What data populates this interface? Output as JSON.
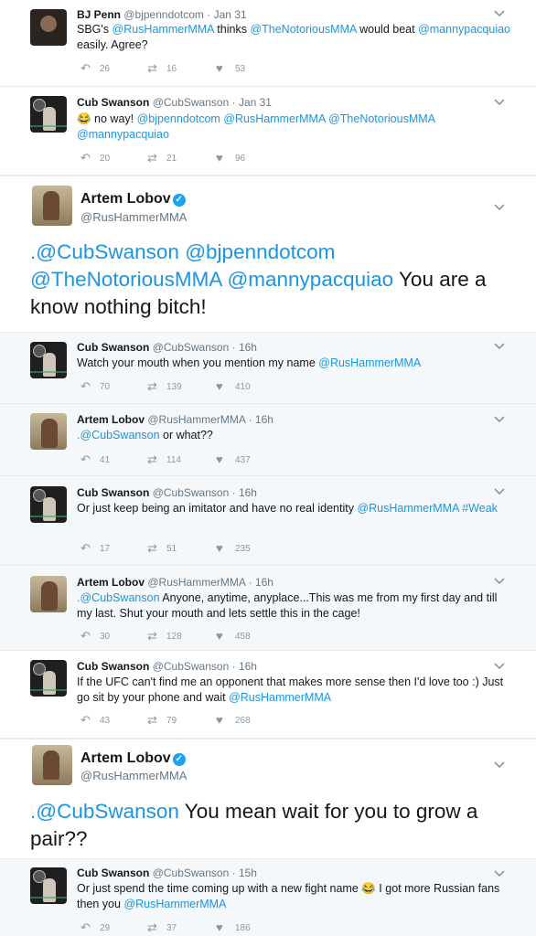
{
  "tweets": [
    {
      "name": "BJ Penn",
      "handle": "@bjpenndotcom",
      "time": "Jan 31",
      "segments": [
        {
          "text": "SBG's ",
          "link": false
        },
        {
          "text": "@RusHammerMMA",
          "link": true
        },
        {
          "text": " thinks ",
          "link": false
        },
        {
          "text": "@TheNotoriousMMA",
          "link": true
        },
        {
          "text": " would beat ",
          "link": false
        },
        {
          "text": "@mannypacquiao",
          "link": true
        },
        {
          "text": " easily. Agree?",
          "link": false
        }
      ],
      "replies": "26",
      "retweets": "16",
      "likes": "53"
    },
    {
      "name": "Cub Swanson",
      "handle": "@CubSwanson",
      "time": "Jan 31",
      "segments": [
        {
          "text": "😂 no way! ",
          "link": false
        },
        {
          "text": "@bjpenndotcom",
          "link": true
        },
        {
          "text": " ",
          "link": false
        },
        {
          "text": "@RusHammerMMA",
          "link": true
        },
        {
          "text": " ",
          "link": false
        },
        {
          "text": "@TheNotoriousMMA",
          "link": true
        },
        {
          "text": " ",
          "link": false
        },
        {
          "text": "@mannypacquiao",
          "link": true
        }
      ],
      "replies": "20",
      "retweets": "21",
      "likes": "96"
    },
    {
      "name": "Artem Lobov",
      "handle": "@RusHammerMMA",
      "segments": [
        {
          "text": ".@CubSwanson",
          "link": true
        },
        {
          "text": " ",
          "link": false
        },
        {
          "text": "@bjpenndotcom",
          "link": true
        },
        {
          "text": " ",
          "link": false
        },
        {
          "text": "@TheNotoriousMMA",
          "link": true
        },
        {
          "text": " ",
          "link": false
        },
        {
          "text": "@mannypacquiao",
          "link": true
        },
        {
          "text": " You are a know nothing bitch!",
          "link": false
        }
      ]
    },
    {
      "name": "Cub Swanson",
      "handle": "@CubSwanson",
      "time": "16h",
      "segments": [
        {
          "text": "Watch your mouth when you mention my name ",
          "link": false
        },
        {
          "text": "@RusHammerMMA",
          "link": true
        }
      ],
      "replies": "70",
      "retweets": "139",
      "likes": "410"
    },
    {
      "name": "Artem Lobov",
      "handle": "@RusHammerMMA",
      "time": "16h",
      "segments": [
        {
          "text": ".@CubSwanson",
          "link": true
        },
        {
          "text": " or what??",
          "link": false
        }
      ],
      "replies": "41",
      "retweets": "114",
      "likes": "437"
    },
    {
      "name": "Cub Swanson",
      "handle": "@CubSwanson",
      "time": "16h",
      "segments": [
        {
          "text": "Or just keep being an imitator and have no real identity ",
          "link": false
        },
        {
          "text": "@RusHammerMMA",
          "link": true
        },
        {
          "text": " ",
          "link": false
        },
        {
          "text": "#Weak",
          "link": true
        }
      ],
      "replies": "17",
      "retweets": "51",
      "likes": "235"
    },
    {
      "name": "Artem Lobov",
      "handle": "@RusHammerMMA",
      "time": "16h",
      "segments": [
        {
          "text": ".@CubSwanson",
          "link": true
        },
        {
          "text": " Anyone, anytime, anyplace...This was me from my first day and till my last. Shut your mouth and lets settle this in the cage!",
          "link": false
        }
      ],
      "replies": "30",
      "retweets": "128",
      "likes": "458"
    },
    {
      "name": "Cub Swanson",
      "handle": "@CubSwanson",
      "time": "16h",
      "segments": [
        {
          "text": "If the UFC can't find me an opponent that makes more sense then I'd love too :) Just go sit by your phone and wait ",
          "link": false
        },
        {
          "text": "@RusHammerMMA",
          "link": true
        }
      ],
      "replies": "43",
      "retweets": "79",
      "likes": "268"
    },
    {
      "name": "Artem Lobov",
      "handle": "@RusHammerMMA",
      "segments": [
        {
          "text": ".@CubSwanson",
          "link": true
        },
        {
          "text": " You mean wait for you to grow a pair??",
          "link": false
        }
      ]
    },
    {
      "name": "Cub Swanson",
      "handle": "@CubSwanson",
      "time": "15h",
      "segments": [
        {
          "text": "Or just spend the time coming up with a new fight name 😂 I got more Russian fans then you ",
          "link": false
        },
        {
          "text": "@RusHammerMMA",
          "link": true
        }
      ],
      "replies": "29",
      "retweets": "37",
      "likes": "186"
    }
  ],
  "icons": {
    "reply": "reply-icon",
    "retweet": "retweet-icon",
    "like": "heart-icon",
    "menu": "chevron-down-icon",
    "verified": "verified-badge-icon"
  },
  "colors": {
    "link": "#1b95e0",
    "muted": "#657786",
    "verified": "#1da1f2"
  }
}
